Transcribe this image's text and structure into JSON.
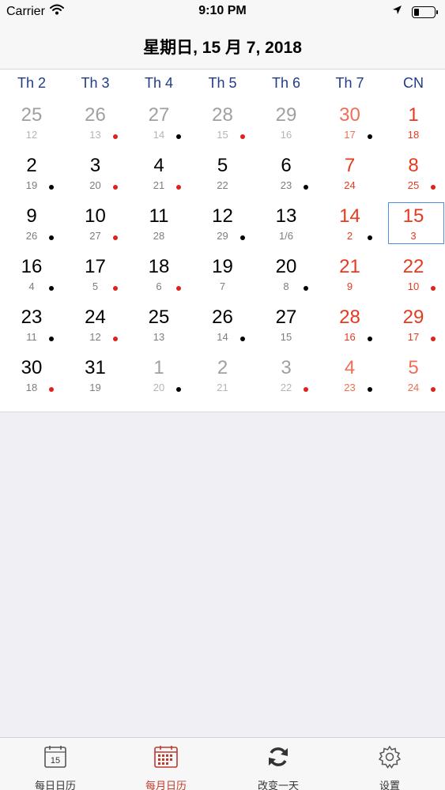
{
  "status_bar": {
    "carrier": "Carrier",
    "time": "9:10 PM",
    "battery_level": 0.25
  },
  "header": {
    "title": "星期日, 15 月 7, 2018"
  },
  "calendar": {
    "weekdays": [
      "Th 2",
      "Th 3",
      "Th 4",
      "Th 5",
      "Th 6",
      "Th 7",
      "CN"
    ],
    "weeks": [
      [
        {
          "day": "25",
          "lunar": "12",
          "other": true,
          "dot": ""
        },
        {
          "day": "26",
          "lunar": "13",
          "other": true,
          "dot": "red"
        },
        {
          "day": "27",
          "lunar": "14",
          "other": true,
          "dot": "black"
        },
        {
          "day": "28",
          "lunar": "15",
          "other": true,
          "dot": "red"
        },
        {
          "day": "29",
          "lunar": "16",
          "other": true,
          "dot": ""
        },
        {
          "day": "30",
          "lunar": "17",
          "other": true,
          "dot": "black"
        },
        {
          "day": "1",
          "lunar": "18",
          "other": false,
          "dot": ""
        }
      ],
      [
        {
          "day": "2",
          "lunar": "19",
          "other": false,
          "dot": "black"
        },
        {
          "day": "3",
          "lunar": "20",
          "other": false,
          "dot": "red"
        },
        {
          "day": "4",
          "lunar": "21",
          "other": false,
          "dot": "red"
        },
        {
          "day": "5",
          "lunar": "22",
          "other": false,
          "dot": ""
        },
        {
          "day": "6",
          "lunar": "23",
          "other": false,
          "dot": "black"
        },
        {
          "day": "7",
          "lunar": "24",
          "other": false,
          "dot": ""
        },
        {
          "day": "8",
          "lunar": "25",
          "other": false,
          "dot": "red"
        }
      ],
      [
        {
          "day": "9",
          "lunar": "26",
          "other": false,
          "dot": "black"
        },
        {
          "day": "10",
          "lunar": "27",
          "other": false,
          "dot": "red"
        },
        {
          "day": "11",
          "lunar": "28",
          "other": false,
          "dot": ""
        },
        {
          "day": "12",
          "lunar": "29",
          "other": false,
          "dot": "black"
        },
        {
          "day": "13",
          "lunar": "1/6",
          "other": false,
          "dot": ""
        },
        {
          "day": "14",
          "lunar": "2",
          "other": false,
          "dot": "black"
        },
        {
          "day": "15",
          "lunar": "3",
          "other": false,
          "dot": "",
          "selected": true
        }
      ],
      [
        {
          "day": "16",
          "lunar": "4",
          "other": false,
          "dot": "black"
        },
        {
          "day": "17",
          "lunar": "5",
          "other": false,
          "dot": "red"
        },
        {
          "day": "18",
          "lunar": "6",
          "other": false,
          "dot": "red"
        },
        {
          "day": "19",
          "lunar": "7",
          "other": false,
          "dot": ""
        },
        {
          "day": "20",
          "lunar": "8",
          "other": false,
          "dot": "black"
        },
        {
          "day": "21",
          "lunar": "9",
          "other": false,
          "dot": ""
        },
        {
          "day": "22",
          "lunar": "10",
          "other": false,
          "dot": "red"
        }
      ],
      [
        {
          "day": "23",
          "lunar": "11",
          "other": false,
          "dot": "black"
        },
        {
          "day": "24",
          "lunar": "12",
          "other": false,
          "dot": "red"
        },
        {
          "day": "25",
          "lunar": "13",
          "other": false,
          "dot": ""
        },
        {
          "day": "26",
          "lunar": "14",
          "other": false,
          "dot": "black"
        },
        {
          "day": "27",
          "lunar": "15",
          "other": false,
          "dot": ""
        },
        {
          "day": "28",
          "lunar": "16",
          "other": false,
          "dot": "black"
        },
        {
          "day": "29",
          "lunar": "17",
          "other": false,
          "dot": "red"
        }
      ],
      [
        {
          "day": "30",
          "lunar": "18",
          "other": false,
          "dot": "red"
        },
        {
          "day": "31",
          "lunar": "19",
          "other": false,
          "dot": ""
        },
        {
          "day": "1",
          "lunar": "20",
          "other": true,
          "dot": "black"
        },
        {
          "day": "2",
          "lunar": "21",
          "other": true,
          "dot": ""
        },
        {
          "day": "3",
          "lunar": "22",
          "other": true,
          "dot": "red"
        },
        {
          "day": "4",
          "lunar": "23",
          "other": true,
          "dot": "black"
        },
        {
          "day": "5",
          "lunar": "24",
          "other": true,
          "dot": "red"
        }
      ]
    ]
  },
  "tab_bar": {
    "active_index": 1,
    "tabs": [
      {
        "label": "每日日历",
        "icon": "calendar-day-icon",
        "badge": "15"
      },
      {
        "label": "每月日历",
        "icon": "calendar-month-icon"
      },
      {
        "label": "改变一天",
        "icon": "refresh-icon"
      },
      {
        "label": "设置",
        "icon": "gear-icon"
      }
    ]
  },
  "colors": {
    "weekday_header": "#1f3b8a",
    "weekend": "#e8391e",
    "dot_red": "#e0211b",
    "dot_black": "#000000",
    "selection": "#4a90e2",
    "active_tab": "#c0392b"
  }
}
